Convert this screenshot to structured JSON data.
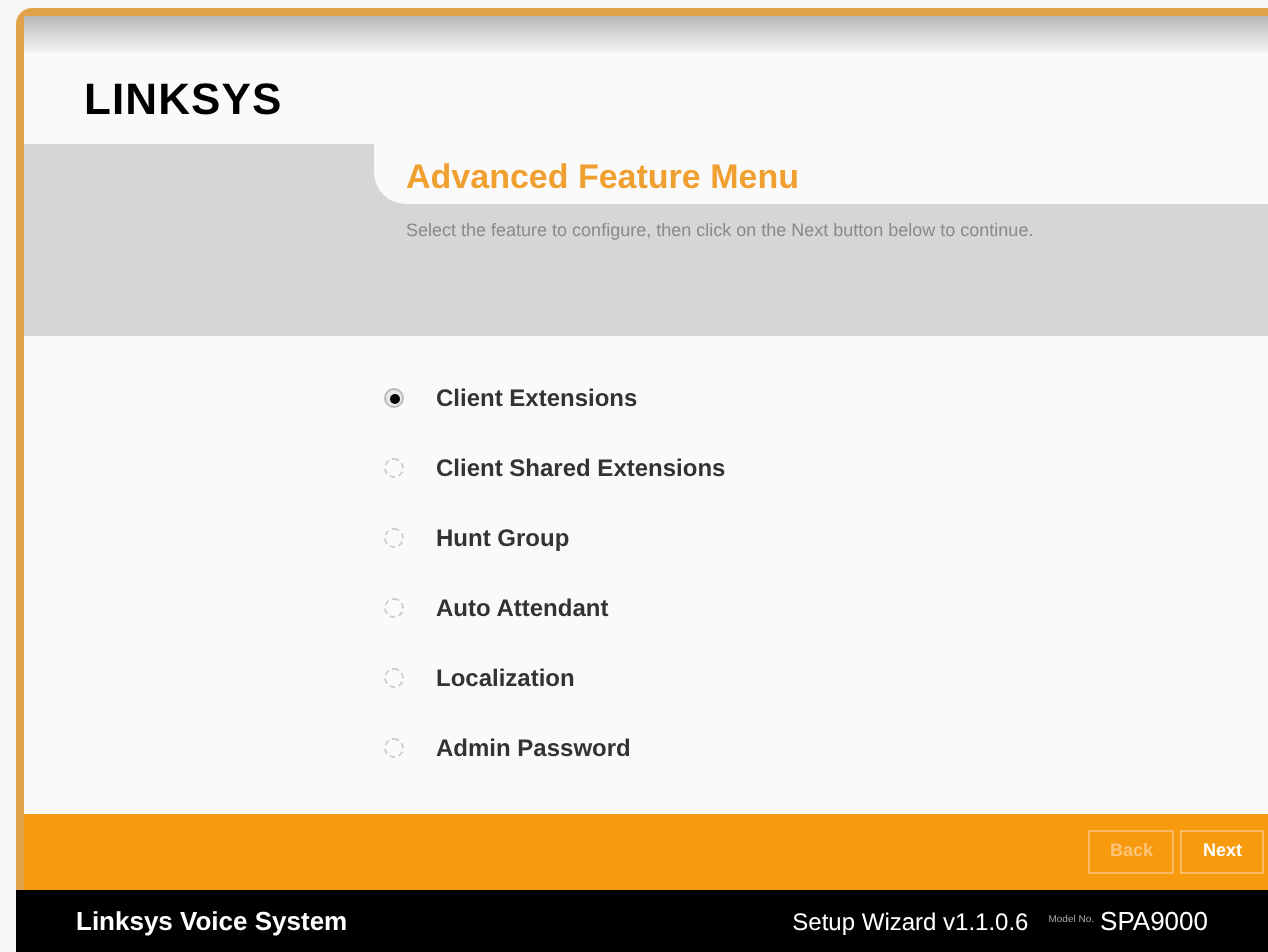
{
  "logo": "LINKSYS",
  "title": "Advanced Feature Menu",
  "description": "Select the feature to configure, then click on the Next button below to continue.",
  "options": [
    {
      "label": "Client Extensions",
      "selected": true
    },
    {
      "label": "Client Shared Extensions",
      "selected": false
    },
    {
      "label": "Hunt Group",
      "selected": false
    },
    {
      "label": "Auto Attendant",
      "selected": false
    },
    {
      "label": "Localization",
      "selected": false
    },
    {
      "label": "Admin Password",
      "selected": false
    }
  ],
  "buttons": [
    {
      "label": "Back",
      "disabled": true
    },
    {
      "label": "Next",
      "disabled": false
    }
  ],
  "footer": {
    "product": "Linksys Voice System",
    "version": "Setup Wizard v1.1.0.6",
    "model_label": "Model No.",
    "model": "SPA9000"
  }
}
